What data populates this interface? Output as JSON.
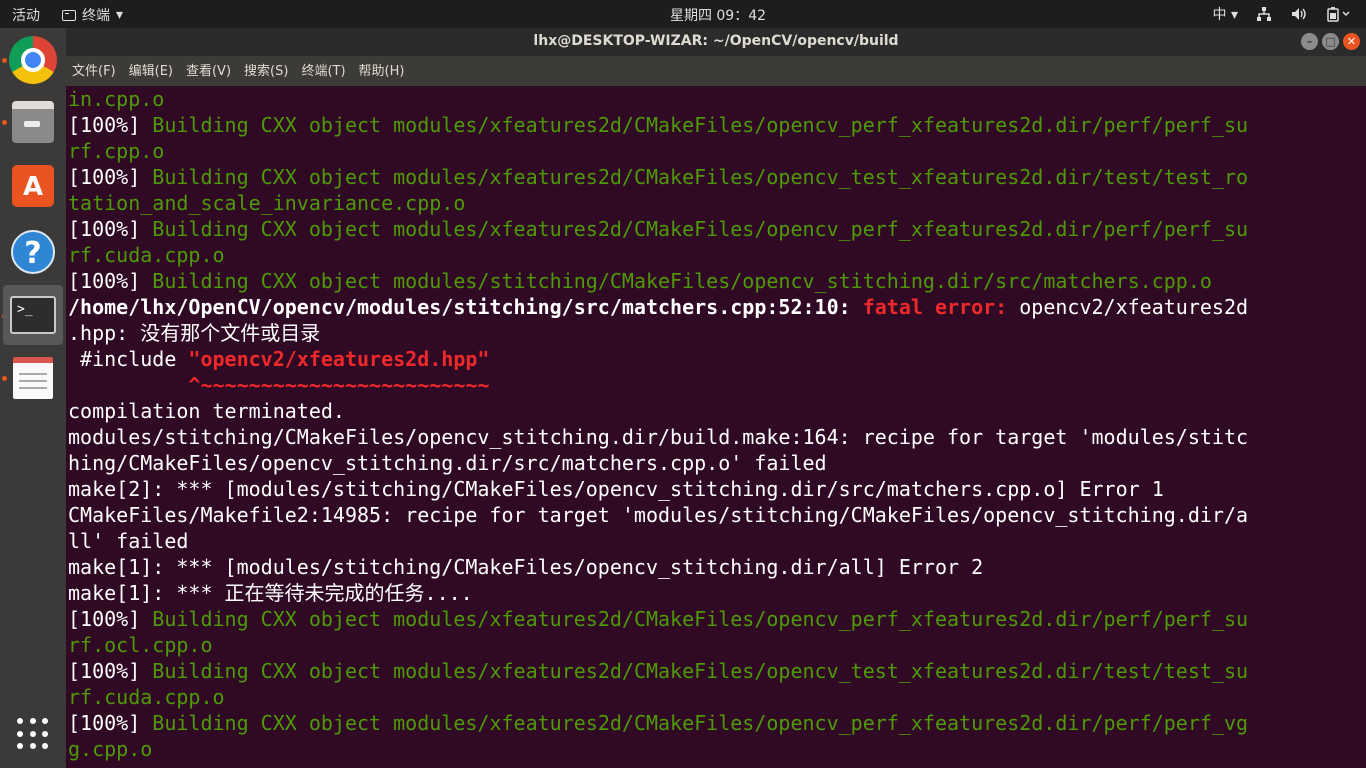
{
  "topbar": {
    "activities": "活动",
    "app_name": "终端",
    "app_arrow": "▾",
    "clock": "星期四 09：42",
    "input_method": "中",
    "input_arrow": "▾"
  },
  "window": {
    "title": "lhx@DESKTOP-WIZAR: ~/OpenCV/opencv/build",
    "min_glyph": "–",
    "max_glyph": "□",
    "close_glyph": "✕"
  },
  "menu": [
    "文件(F)",
    "编辑(E)",
    "查看(V)",
    "搜索(S)",
    "终端(T)",
    "帮助(H)"
  ],
  "dock": {
    "store_glyph": "A",
    "help_glyph": "?",
    "term_glyph": ">_"
  },
  "terminal": {
    "l01": "in.cpp.o",
    "l02a": "[100%] ",
    "l02b": "Building CXX object modules/xfeatures2d/CMakeFiles/opencv_perf_xfeatures2d.dir/perf/perf_su",
    "l03": "rf.cpp.o",
    "l04a": "[100%] ",
    "l04b": "Building CXX object modules/xfeatures2d/CMakeFiles/opencv_test_xfeatures2d.dir/test/test_ro",
    "l05": "tation_and_scale_invariance.cpp.o",
    "l06a": "[100%] ",
    "l06b": "Building CXX object modules/xfeatures2d/CMakeFiles/opencv_perf_xfeatures2d.dir/perf/perf_su",
    "l07": "rf.cuda.cpp.o",
    "l08a": "[100%] ",
    "l08b": "Building CXX object modules/stitching/CMakeFiles/opencv_stitching.dir/src/matchers.cpp.o",
    "l09a": "/home/lhx/OpenCV/opencv/modules/stitching/src/matchers.cpp:52:10: ",
    "l09b": "fatal error: ",
    "l09c": "opencv2/xfeatures2d",
    "l10": ".hpp: 没有那个文件或目录",
    "l11a": " #include ",
    "l11b": "\"opencv2/xfeatures2d.hpp\"",
    "l12": "          ^~~~~~~~~~~~~~~~~~~~~~~~~",
    "l13": "compilation terminated.",
    "l14": "modules/stitching/CMakeFiles/opencv_stitching.dir/build.make:164: recipe for target 'modules/stitc",
    "l15": "hing/CMakeFiles/opencv_stitching.dir/src/matchers.cpp.o' failed",
    "l16": "make[2]: *** [modules/stitching/CMakeFiles/opencv_stitching.dir/src/matchers.cpp.o] Error 1",
    "l17": "CMakeFiles/Makefile2:14985: recipe for target 'modules/stitching/CMakeFiles/opencv_stitching.dir/a",
    "l18": "ll' failed",
    "l19": "make[1]: *** [modules/stitching/CMakeFiles/opencv_stitching.dir/all] Error 2",
    "l20": "make[1]: *** 正在等待未完成的任务....",
    "l21a": "[100%] ",
    "l21b": "Building CXX object modules/xfeatures2d/CMakeFiles/opencv_perf_xfeatures2d.dir/perf/perf_su",
    "l22": "rf.ocl.cpp.o",
    "l23a": "[100%] ",
    "l23b": "Building CXX object modules/xfeatures2d/CMakeFiles/opencv_test_xfeatures2d.dir/test/test_su",
    "l24": "rf.cuda.cpp.o",
    "l25a": "[100%] ",
    "l25b": "Building CXX object modules/xfeatures2d/CMakeFiles/opencv_perf_xfeatures2d.dir/perf/perf_vg",
    "l26": "g.cpp.o"
  }
}
